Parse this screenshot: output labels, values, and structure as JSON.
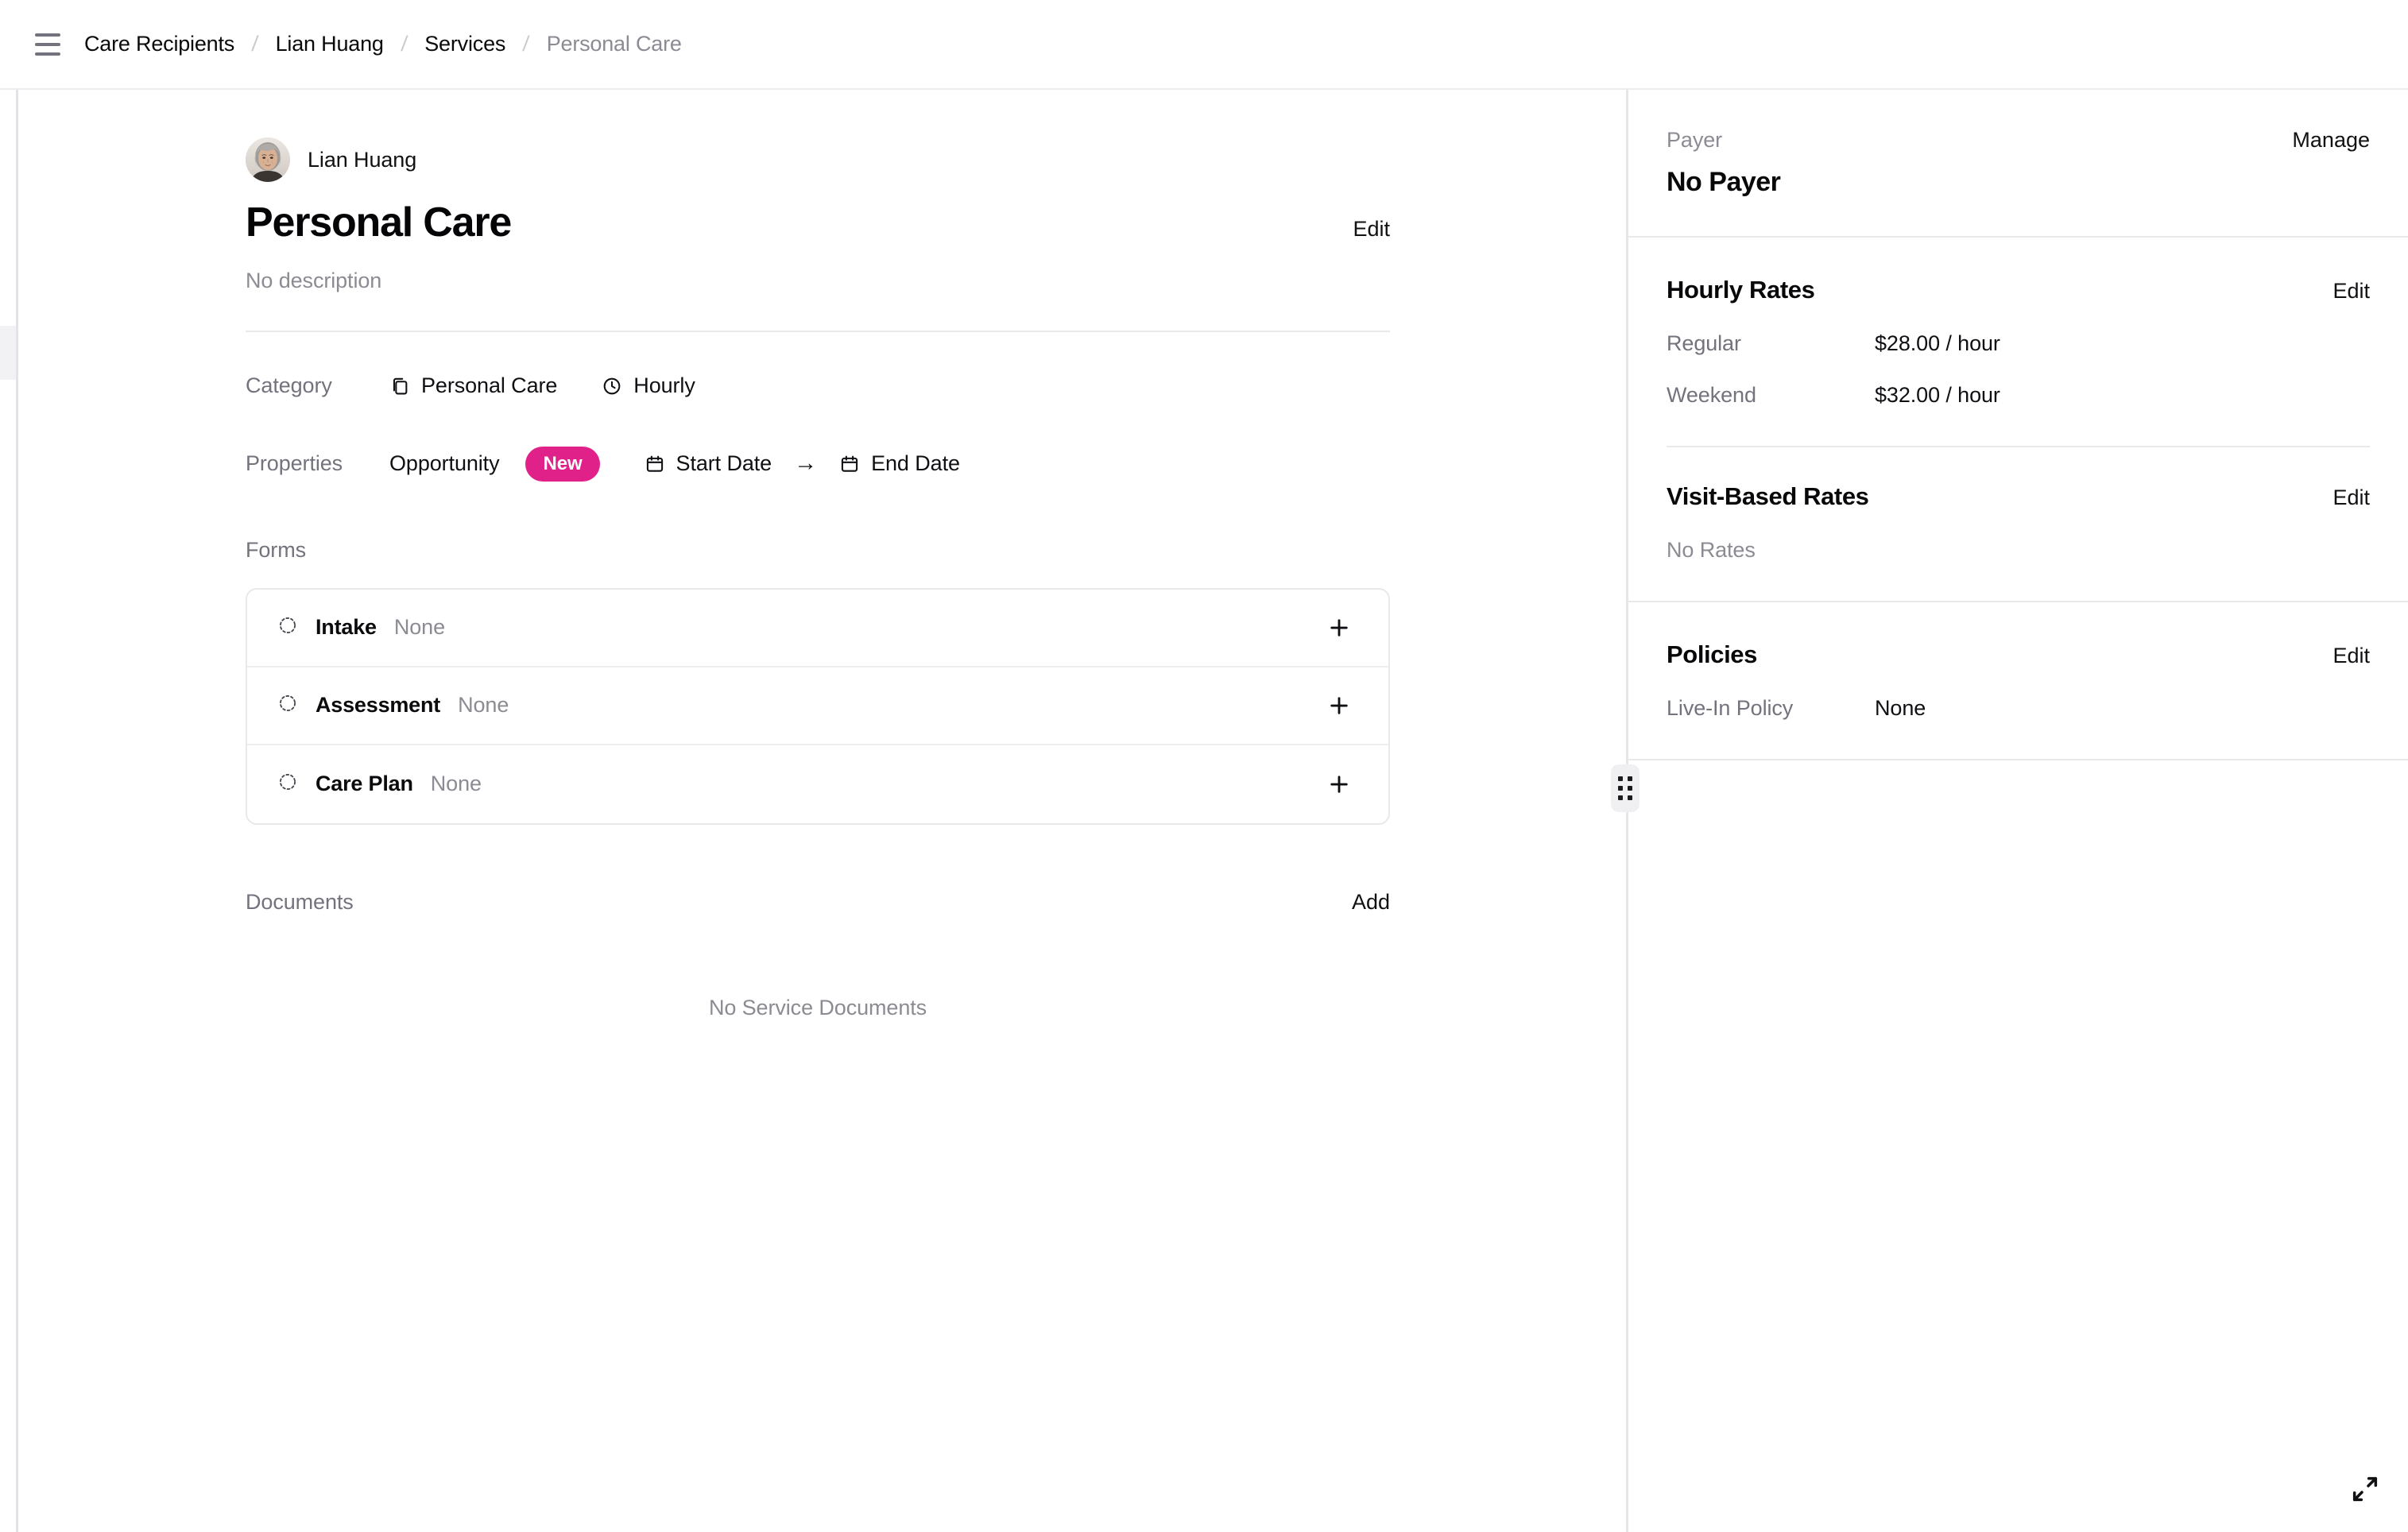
{
  "topbar": {
    "menu_icon": "hamburger-menu-icon",
    "breadcrumbs": [
      {
        "label": "Care Recipients",
        "muted": false
      },
      {
        "label": "Lian Huang",
        "muted": false
      },
      {
        "label": "Services",
        "muted": false
      },
      {
        "label": "Personal Care",
        "muted": true
      }
    ],
    "separator": "/"
  },
  "main": {
    "person_name": "Lian Huang",
    "avatar_name": "lian-huang-avatar",
    "title": "Personal Care",
    "edit_label": "Edit",
    "description": "No description",
    "category": {
      "label": "Category",
      "value": "Personal Care",
      "value_icon": "copy-icon",
      "billing": "Hourly",
      "billing_icon": "clock-icon"
    },
    "properties": {
      "label": "Properties",
      "opportunity_label": "Opportunity",
      "new_badge": "New",
      "start_date_label": "Start Date",
      "end_date_label": "End Date",
      "arrow": "→"
    },
    "forms": {
      "label": "Forms",
      "rows": [
        {
          "name": "Intake",
          "value": "None"
        },
        {
          "name": "Assessment",
          "value": "None"
        },
        {
          "name": "Care Plan",
          "value": "None"
        }
      ],
      "add_icon": "plus-icon"
    },
    "documents": {
      "label": "Documents",
      "add_label": "Add",
      "empty_text": "No Service Documents"
    }
  },
  "right_panel": {
    "payer": {
      "kicker": "Payer",
      "action": "Manage",
      "value": "No Payer"
    },
    "hourly_rates": {
      "title": "Hourly Rates",
      "action": "Edit",
      "rows": [
        {
          "key": "Regular",
          "value": "$28.00 / hour"
        },
        {
          "key": "Weekend",
          "value": "$32.00 / hour"
        }
      ]
    },
    "visit_based_rates": {
      "title": "Visit-Based Rates",
      "action": "Edit",
      "empty": "No Rates"
    },
    "policies": {
      "title": "Policies",
      "action": "Edit",
      "rows": [
        {
          "key": "Live-In Policy",
          "value": "None"
        }
      ]
    },
    "drag_handle_name": "panel-resize-handle"
  },
  "footer": {
    "expand_icon": "expand-diagonal-icon"
  },
  "colors": {
    "accent_pink": "#e0218a",
    "text_primary": "#0a0a0b",
    "text_muted": "#8b8b93",
    "border": "#e9e9ec"
  }
}
